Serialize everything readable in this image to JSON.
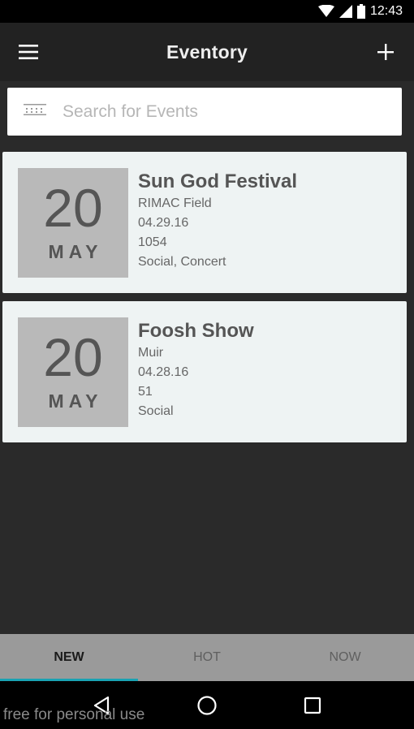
{
  "status_bar": {
    "time": "12:43",
    "icons": [
      "wifi-icon",
      "cell-signal-icon",
      "battery-icon"
    ]
  },
  "app_bar": {
    "title": "Eventory",
    "menu_icon": "hamburger-menu-icon",
    "add_icon": "plus-icon"
  },
  "search": {
    "placeholder": "Search for Events",
    "value": "",
    "icon": "calendar-icon"
  },
  "events": [
    {
      "day": "20",
      "month": "MAY",
      "title": "Sun God Festival",
      "location": "RIMAC Field",
      "date": "04.29.16",
      "count": "1054",
      "tags": "Social, Concert"
    },
    {
      "day": "20",
      "month": "MAY",
      "title": "Foosh Show",
      "location": "Muir",
      "date": "04.28.16",
      "count": "51",
      "tags": "Social"
    }
  ],
  "tabs": [
    {
      "label": "NEW",
      "active": true
    },
    {
      "label": "HOT",
      "active": false
    },
    {
      "label": "NOW",
      "active": false
    }
  ],
  "nav_bar": {
    "icons": [
      "back-triangle-icon",
      "home-circle-icon",
      "recents-square-icon"
    ]
  },
  "watermark": "free for personal use",
  "colors": {
    "accent": "#1aa3b3",
    "card": "#eef3f3",
    "date_block": "#b9b9b9",
    "background": "#2a2a2a"
  }
}
